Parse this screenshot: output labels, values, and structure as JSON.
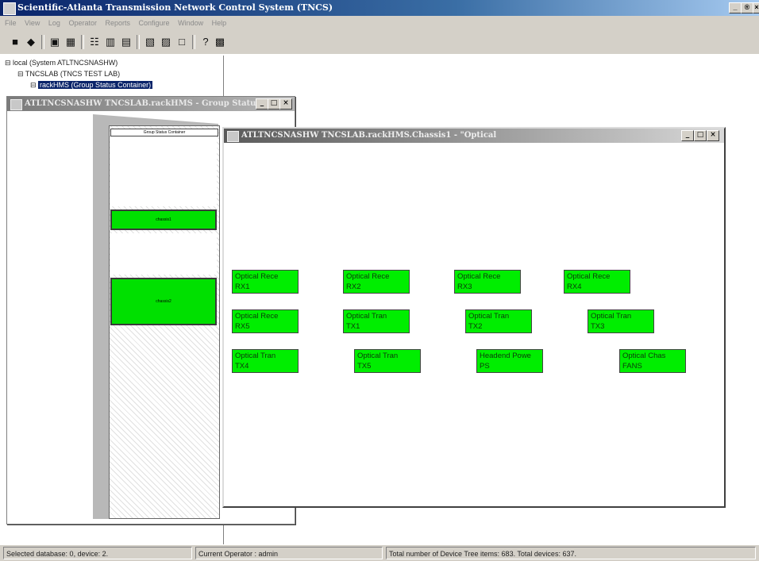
{
  "app": {
    "title": "Scientific-Atlanta Transmission Network Control System (TNCS)",
    "window_buttons": [
      "_",
      "®",
      "×"
    ]
  },
  "menu": [
    "File",
    "View",
    "Log",
    "Operator",
    "Reports",
    "Configure",
    "Window",
    "Help"
  ],
  "toolbar": [
    {
      "name": "save-icon",
      "glyph": "■"
    },
    {
      "name": "open-icon",
      "glyph": "◆"
    },
    {
      "name": "network-icon",
      "glyph": "▣"
    },
    {
      "name": "grid-icon",
      "glyph": "▦"
    },
    {
      "name": "tree-icon",
      "glyph": "☷"
    },
    {
      "name": "rack-icon",
      "glyph": "▥"
    },
    {
      "name": "chart-icon",
      "glyph": "▤"
    },
    {
      "name": "window-icon",
      "glyph": "▧"
    },
    {
      "name": "list-icon",
      "glyph": "▨"
    },
    {
      "name": "panel-icon",
      "glyph": "□"
    },
    {
      "name": "help-icon",
      "glyph": "?"
    },
    {
      "name": "context-help-icon",
      "glyph": "▩"
    }
  ],
  "tree": {
    "root": "local (System ATLTNCSNASHW)",
    "lab": "TNCSLAB (TNCS TEST LAB)",
    "container": "rackHMS (Group Status Container)"
  },
  "window1": {
    "title": "ATLTNCSNASHW TNCSLAB.rackHMS - Group Status C...",
    "rack_header": "Group Status Container",
    "slots": [
      "chassis1",
      "chassis2"
    ]
  },
  "window2": {
    "title": "ATLTNCSNASHW TNCSLAB.rackHMS.Chassis1 - \"Optical",
    "components": [
      {
        "line1": "Optical Rece",
        "line2": "RX1"
      },
      {
        "line1": "Optical Rece",
        "line2": "RX2"
      },
      {
        "line1": "Optical Rece",
        "line2": "RX3"
      },
      {
        "line1": "Optical Rece",
        "line2": "RX4"
      },
      {
        "line1": "Optical Rece",
        "line2": "RX5"
      },
      {
        "line1": "Optical Tran",
        "line2": "TX1"
      },
      {
        "line1": "Optical Tran",
        "line2": "TX2"
      },
      {
        "line1": "Optical Tran",
        "line2": "TX3"
      },
      {
        "line1": "Optical Tran",
        "line2": "TX4"
      },
      {
        "line1": "Optical Tran",
        "line2": "TX5"
      },
      {
        "line1": "Headend Powe",
        "line2": "PS"
      },
      {
        "line1": "Optical Chas",
        "line2": "FANS"
      }
    ]
  },
  "status": {
    "database": "Selected database: 0, device: 2.",
    "operator": "Current Operator : admin",
    "totals": "Total number of Device Tree items: 683. Total devices: 637."
  },
  "colors": {
    "component_ok": "#00ee00",
    "title_active": "#0a246a",
    "title_inactive": "#808080"
  }
}
